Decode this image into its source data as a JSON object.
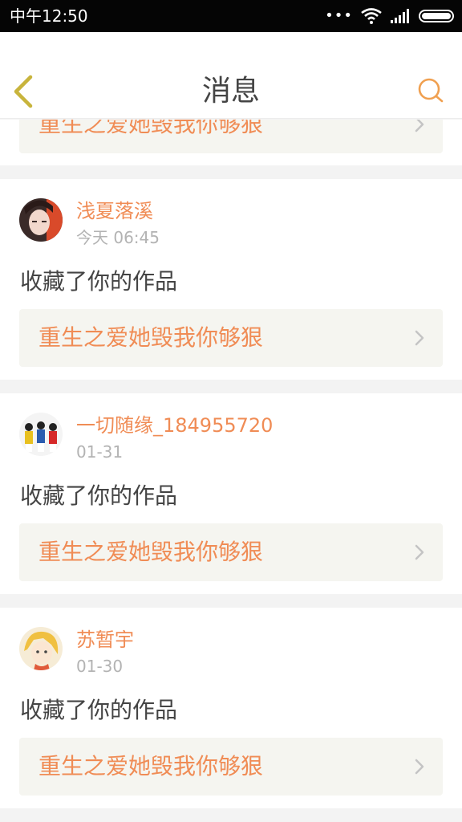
{
  "status_bar": {
    "time": "中午12:50",
    "dots": "•••"
  },
  "header": {
    "title": "消息"
  },
  "partial_card": {
    "work_title": "重生之爱她毁我你够狠"
  },
  "messages": [
    {
      "username": "浅夏落溪",
      "time": "今天 06:45",
      "action": "收藏了你的作品",
      "work_title": "重生之爱她毁我你够狠"
    },
    {
      "username": "一切随缘_184955720",
      "time": "01-31",
      "action": "收藏了你的作品",
      "work_title": "重生之爱她毁我你够狠"
    },
    {
      "username": "苏暂宇",
      "time": "01-30",
      "action": "收藏了你的作品",
      "work_title": "重生之爱她毁我你够狠"
    }
  ],
  "colors": {
    "accent": "#f08c55",
    "back_icon": "#c8b43c",
    "search_icon": "#f0a050"
  },
  "icons": {
    "back": "back-chevron-icon",
    "search": "search-icon",
    "wifi": "wifi-icon",
    "signal": "signal-icon",
    "battery": "battery-icon",
    "chevron": "chevron-right-icon"
  }
}
